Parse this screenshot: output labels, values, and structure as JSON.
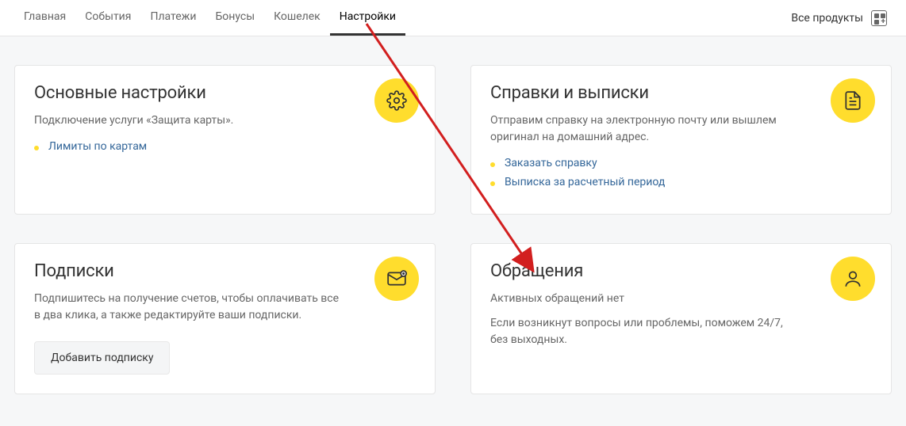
{
  "nav": {
    "tabs": [
      "Главная",
      "События",
      "Платежи",
      "Бонусы",
      "Кошелек",
      "Настройки"
    ],
    "active": 5,
    "all_products": "Все продукты"
  },
  "cards": {
    "basic_settings": {
      "title": "Основные настройки",
      "desc": "Подключение услуги «Защита карты».",
      "links": [
        "Лимиты по картам"
      ]
    },
    "statements": {
      "title": "Справки и выписки",
      "desc": "Отправим справку на электронную почту или вышлем оригинал на домашний адрес.",
      "links": [
        "Заказать справку",
        "Выписка за расчетный период"
      ]
    },
    "subscriptions": {
      "title": "Подписки",
      "desc": "Подпишитесь на получение счетов, чтобы оплачивать все в два клика, а также редактируйте ваши подписки.",
      "button": "Добавить подписку"
    },
    "tickets": {
      "title": "Обращения",
      "sub": "Активных обращений нет",
      "desc": "Если возникнут вопросы или проблемы, поможем 24/7, без выходных."
    }
  }
}
